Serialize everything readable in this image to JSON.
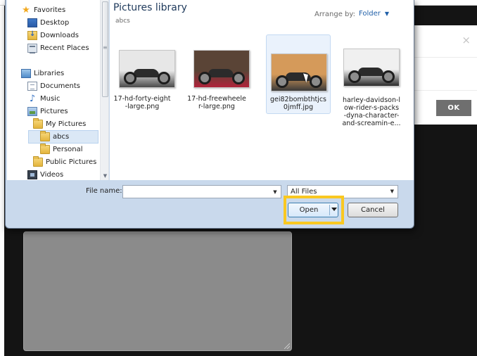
{
  "navigation": {
    "items": [
      {
        "label": "Favorites",
        "icon": "star-icon"
      },
      {
        "label": "Desktop",
        "icon": "desktop-icon"
      },
      {
        "label": "Downloads",
        "icon": "downloads-icon"
      },
      {
        "label": "Recent Places",
        "icon": "recent-places-icon"
      },
      {
        "label": "Libraries",
        "icon": "libraries-icon"
      },
      {
        "label": "Documents",
        "icon": "documents-icon"
      },
      {
        "label": "Music",
        "icon": "music-icon"
      },
      {
        "label": "Pictures",
        "icon": "pictures-icon"
      },
      {
        "label": "My Pictures",
        "icon": "folder-icon"
      },
      {
        "label": "abcs",
        "icon": "folder-icon",
        "selected": true
      },
      {
        "label": "Personal",
        "icon": "folder-icon"
      },
      {
        "label": "Public Pictures",
        "icon": "folder-icon"
      },
      {
        "label": "Videos",
        "icon": "videos-icon"
      }
    ]
  },
  "library": {
    "title": "Pictures library",
    "subtitle": "abcs",
    "arrange_label": "Arrange by:",
    "arrange_value": "Folder"
  },
  "files": [
    {
      "name": "17-hd-forty-eight\n-large.png",
      "palette": [
        "#e7e7e7",
        "#4a4a4a"
      ]
    },
    {
      "name": "17-hd-freewheele\nr-large.png",
      "palette": [
        "#5a4436",
        "#b0233a"
      ]
    },
    {
      "name": "gei82bombthtjcs\n0jmff.jpg",
      "palette": [
        "#d59a5a",
        "#3a3a3a"
      ],
      "selected": true
    },
    {
      "name": "harley-davidson-l\now-rider-s-packs\n-dyna-character-\nand-screamin-e...",
      "palette": [
        "#f0f0f0",
        "#2b2b2b"
      ]
    }
  ],
  "footer": {
    "filename_label": "File name:",
    "filename_value": "",
    "filetype": "All Files",
    "open_label": "Open",
    "cancel_label": "Cancel"
  },
  "background": {
    "ok_label": "OK",
    "close_glyph": "×"
  },
  "colors": {
    "highlight": "#f9c821",
    "accent": "#1f5fa8"
  }
}
